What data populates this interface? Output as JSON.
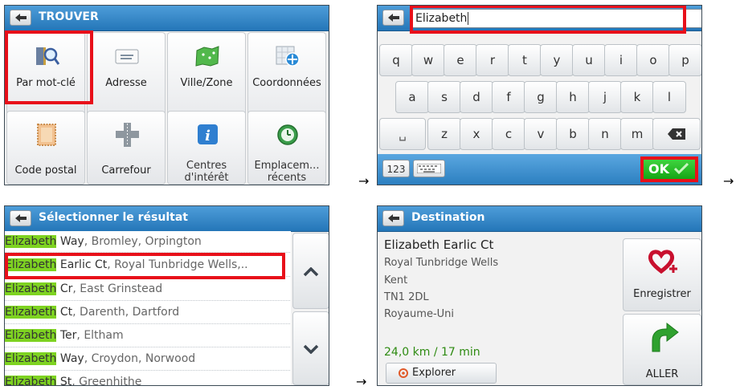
{
  "find_screen": {
    "title": "TROUVER",
    "tiles": [
      {
        "label": "Par mot-clé",
        "icon": "keyword-search-icon"
      },
      {
        "label": "Adresse",
        "icon": "address-card-icon"
      },
      {
        "label": "Ville/Zone",
        "icon": "city-map-icon"
      },
      {
        "label": "Coordonnées",
        "icon": "coordinates-icon"
      },
      {
        "label": "Code postal",
        "icon": "postcode-stamp-icon"
      },
      {
        "label": "Carrefour",
        "icon": "intersection-icon"
      },
      {
        "label": "Centres\nd'intérêt",
        "icon": "info-icon"
      },
      {
        "label": "Emplacem...\nrécents",
        "icon": "recent-clock-icon"
      }
    ]
  },
  "keyboard_screen": {
    "input_value": "Elizabeth",
    "row1": [
      "q",
      "w",
      "e",
      "r",
      "t",
      "y",
      "u",
      "i",
      "o",
      "p"
    ],
    "row2": [
      "a",
      "s",
      "d",
      "f",
      "g",
      "h",
      "j",
      "k",
      "l"
    ],
    "row3": [
      "z",
      "x",
      "c",
      "v",
      "b",
      "n",
      "m"
    ],
    "space_key": "␣",
    "numeric_label": "123",
    "ok_label": "OK"
  },
  "results_screen": {
    "title": "Sélectionner le résultat",
    "highlight": "Elizabeth",
    "rows": [
      {
        "street": "Way",
        "rest": ", Bromley, Orpington"
      },
      {
        "street": "Earlic Ct",
        "rest": ", Royal Tunbridge Wells,.."
      },
      {
        "street": "Cr",
        "rest": ", East Grinstead"
      },
      {
        "street": "Ct",
        "rest": ", Darenth, Dartford"
      },
      {
        "street": "Ter",
        "rest": ", Eltham"
      },
      {
        "street": "Way",
        "rest": ", Croydon, Norwood"
      },
      {
        "street": "St",
        "rest": ", Greenhithe"
      }
    ]
  },
  "destination_screen": {
    "title": "Destination",
    "name": "Elizabeth Earlic Ct",
    "address_lines": [
      "Royal Tunbridge Wells",
      "Kent",
      "TN1 2DL",
      "Royaume-Uni"
    ],
    "distance_time": "24,0 km / 17 min",
    "explore_label": "Explorer",
    "save_label": "Enregistrer",
    "go_label": "ALLER"
  },
  "flow_arrow": "→",
  "colors": {
    "header_blue": "#2f86c9",
    "highlight_green": "#7ed321",
    "ok_green": "#22b522",
    "callout_red": "#e8101a",
    "distance_green": "#2e8b12"
  }
}
